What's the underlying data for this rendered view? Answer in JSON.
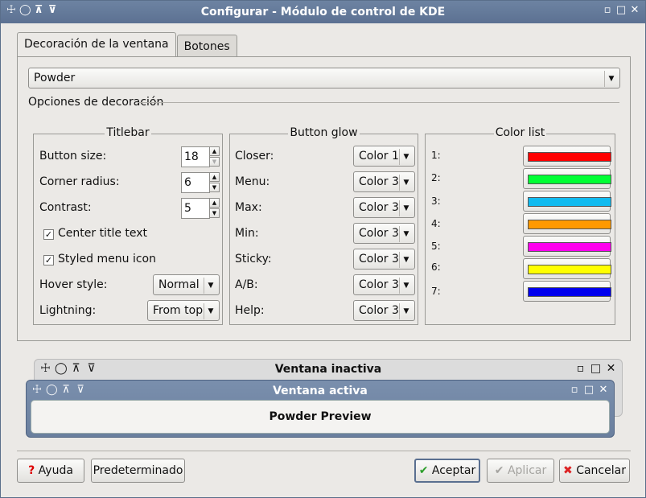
{
  "window": {
    "title": "Configurar - Módulo de control de KDE"
  },
  "tabs": [
    {
      "label": "Decoración de la ventana"
    },
    {
      "label": "Botones"
    }
  ],
  "decoration": {
    "selected": "Powder",
    "options_label": "Opciones de decoración"
  },
  "titlebar_group": {
    "title": "Titlebar",
    "button_size_label": "Button size:",
    "button_size": "18",
    "corner_radius_label": "Corner radius:",
    "corner_radius": "6",
    "contrast_label": "Contrast:",
    "contrast": "5",
    "center_title_label": "Center title text",
    "center_title_checked": true,
    "styled_menu_label": "Styled menu icon",
    "styled_menu_checked": true,
    "hover_style_label": "Hover style:",
    "hover_style": "Normal",
    "lightning_label": "Lightning:",
    "lightning": "From top"
  },
  "glow_group": {
    "title": "Button glow",
    "rows": [
      {
        "label": "Closer:",
        "value": "Color 1"
      },
      {
        "label": "Menu:",
        "value": "Color 3"
      },
      {
        "label": "Max:",
        "value": "Color 3"
      },
      {
        "label": "Min:",
        "value": "Color 3"
      },
      {
        "label": "Sticky:",
        "value": "Color 3"
      },
      {
        "label": "A/B:",
        "value": "Color 3"
      },
      {
        "label": "Help:",
        "value": "Color 3"
      }
    ]
  },
  "color_group": {
    "title": "Color list",
    "items": [
      {
        "label": "1:",
        "color": "#ff0000"
      },
      {
        "label": "2:",
        "color": "#00ff33"
      },
      {
        "label": "3:",
        "color": "#11bbf0"
      },
      {
        "label": "4:",
        "color": "#ff9900"
      },
      {
        "label": "5:",
        "color": "#ff00ee"
      },
      {
        "label": "6:",
        "color": "#ffff00"
      },
      {
        "label": "7:",
        "color": "#0000ee"
      }
    ]
  },
  "preview": {
    "inactive_title": "Ventana inactiva",
    "active_title": "Ventana activa",
    "body": "Powder Preview"
  },
  "buttons": {
    "help": "Ayuda",
    "defaults": "Predeterminado",
    "ok": "Aceptar",
    "apply": "Aplicar",
    "cancel": "Cancelar"
  }
}
